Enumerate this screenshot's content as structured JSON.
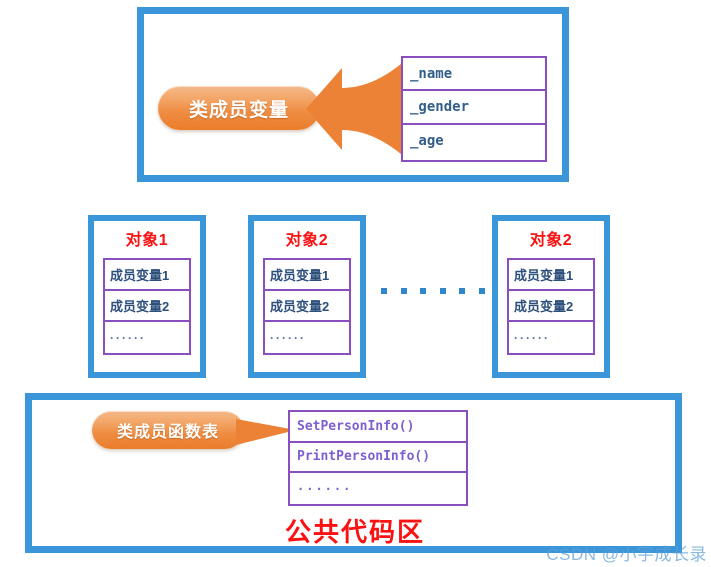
{
  "theme": {
    "frame_blue": "#3a96d9",
    "pill_orange": "#ef8d43",
    "table_purple": "#8a4fbf",
    "title_red": "#fa1111",
    "member_text_blue": "#335e8c",
    "func_text_purple": "#7d5fd0",
    "background": "#ffffff"
  },
  "top_section": {
    "pill_label": "类成员变量",
    "arrow_direction": "left",
    "member_table": {
      "rows": [
        "_name",
        "_gender",
        "_age"
      ]
    }
  },
  "objects_section": {
    "boxes": [
      {
        "title": "对象1",
        "rows": [
          "成员变量1",
          "成员变量2",
          "······"
        ]
      },
      {
        "title": "对象2",
        "rows": [
          "成员变量1",
          "成员变量2",
          "······"
        ]
      },
      {
        "title": "对象2",
        "rows": [
          "成员变量1",
          "成员变量2",
          "······"
        ]
      }
    ],
    "ellipsis_dot_count": 6
  },
  "bottom_section": {
    "pill_label": "类成员函数表",
    "func_table": {
      "rows": [
        "SetPersonInfo()",
        "PrintPersonInfo()",
        "······"
      ]
    },
    "area_label": "公共代码区"
  },
  "watermark": {
    "text": "CSDN @小宇成长录"
  }
}
